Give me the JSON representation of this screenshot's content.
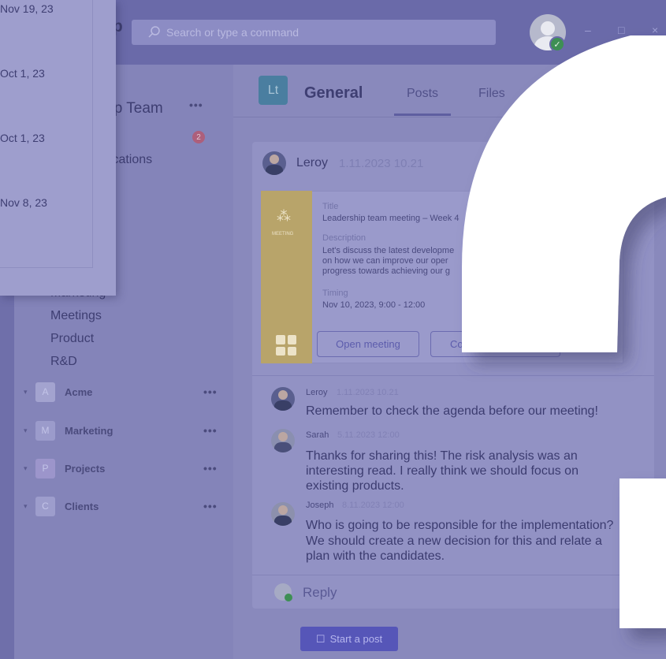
{
  "popup": {
    "dates": [
      "Nov 19, 23",
      "Oct 1, 23",
      "Oct 1, 23",
      "Nov 8, 23"
    ]
  },
  "search": {
    "placeholder": "Search or type a command"
  },
  "window": {
    "minimize": "–",
    "maximize": "□",
    "close": "×"
  },
  "sidebar": {
    "title_fragment": "tip",
    "team_fragment": "hip Team",
    "apps_fragment": "nications",
    "badge": "2",
    "channels_partial": "Marketing",
    "channels": [
      "Meetings",
      "Product",
      "R&D"
    ],
    "teams": [
      {
        "letter": "A",
        "name": "Acme",
        "color": "#a3a3cf"
      },
      {
        "letter": "M",
        "name": "Marketing",
        "color": "#9b9bcb"
      },
      {
        "letter": "P",
        "name": "Projects",
        "color": "#9c95cb"
      },
      {
        "letter": "C",
        "name": "Clients",
        "color": "#9d9dcc"
      }
    ],
    "more": "•••"
  },
  "channel": {
    "tile": "Lt",
    "title": "General",
    "tabs": [
      "Posts",
      "Files"
    ]
  },
  "post": {
    "author": "Leroy",
    "time": "1.11.2023 10.21",
    "meeting": {
      "strip_word": "MEETING",
      "title_label": "Title",
      "title": "Leadership team meeting – Week 4",
      "description_label": "Description",
      "description_lines": [
        "Let's discuss the latest developme",
        "on how we can improve our oper",
        "progress towards achieving our g"
      ],
      "timing_label": "Timing",
      "timing": "Nov 10, 2023, 9:00 - 12:00",
      "open_button": "Open meeting",
      "second_button": "Co"
    },
    "replies": [
      {
        "name": "Leroy",
        "time": "1.11.2023 10.21",
        "lines": [
          "Remember to check the agenda before our meeting!"
        ]
      },
      {
        "name": "Sarah",
        "time": "5.11.2023 12:00",
        "lines": [
          "Thanks for sharing this! The risk analysis was an",
          "interesting read. I really think we should focus on",
          "existing products."
        ]
      },
      {
        "name": "Joseph",
        "time": "8.11.2023 12:00",
        "lines": [
          "Who is going to be responsible for the implementation?",
          "We should create a new decision for this and relate a",
          "plan with the candidates."
        ]
      }
    ],
    "reply_label": "Reply"
  },
  "compose": {
    "start_post": "Start a post"
  }
}
